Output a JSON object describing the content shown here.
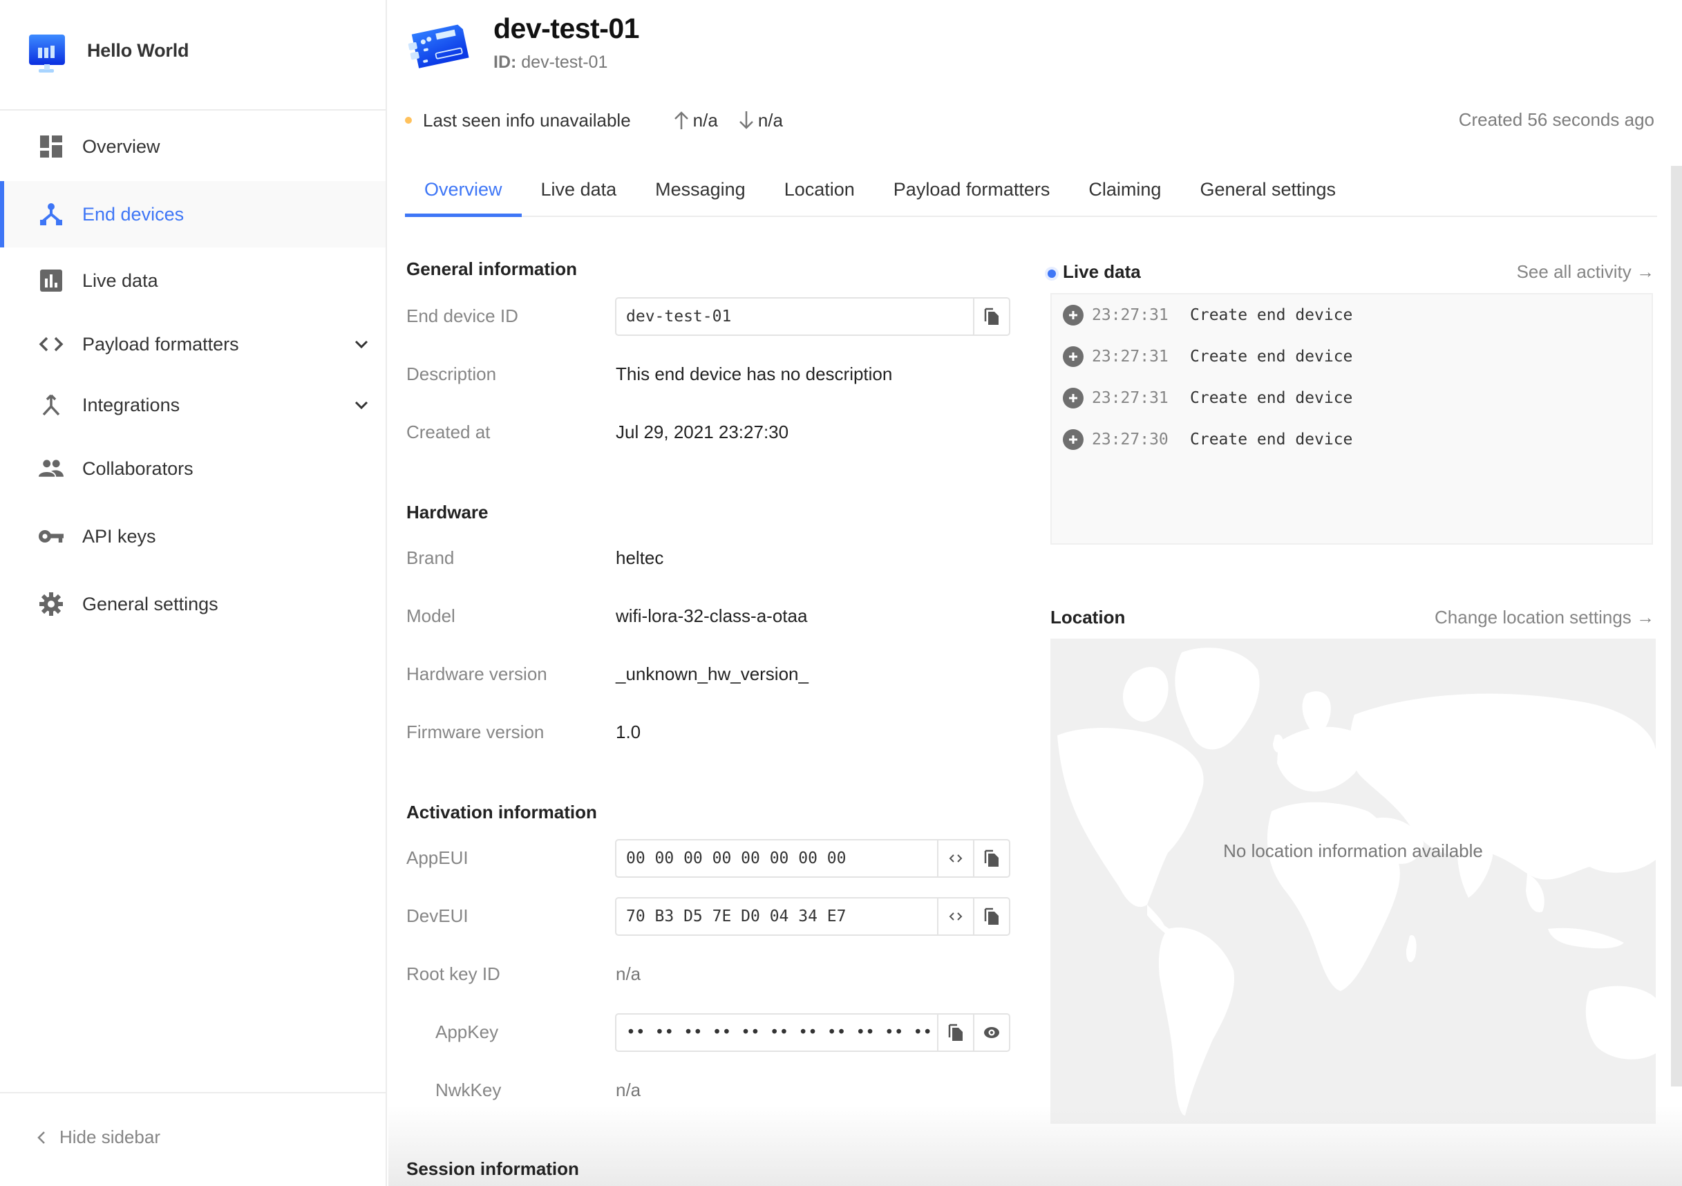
{
  "app": {
    "name": "Hello World",
    "logo_icon": "application-monitor-icon"
  },
  "sidebar": {
    "items": [
      {
        "label": "Overview",
        "icon": "dashboard-icon",
        "active": false,
        "expandable": false
      },
      {
        "label": "End devices",
        "icon": "devices-tree-icon",
        "active": true,
        "expandable": false
      },
      {
        "label": "Live data",
        "icon": "bar-chart-icon",
        "active": false,
        "expandable": false
      },
      {
        "label": "Payload formatters",
        "icon": "code-icon",
        "active": false,
        "expandable": true
      },
      {
        "label": "Integrations",
        "icon": "merge-icon",
        "active": false,
        "expandable": true
      },
      {
        "label": "Collaborators",
        "icon": "people-icon",
        "active": false,
        "expandable": false
      },
      {
        "label": "API keys",
        "icon": "key-icon",
        "active": false,
        "expandable": false
      },
      {
        "label": "General settings",
        "icon": "gear-icon",
        "active": false,
        "expandable": false
      }
    ],
    "hide_label": "Hide sidebar"
  },
  "device": {
    "title": "dev-test-01",
    "id_label": "ID:",
    "id_value": "dev-test-01",
    "last_seen": "Last seen info unavailable",
    "uplink": "n/a",
    "downlink": "n/a",
    "created_ago": "Created 56 seconds ago",
    "status_color": "#ffc15c"
  },
  "tabs": [
    {
      "label": "Overview",
      "active": true
    },
    {
      "label": "Live data",
      "active": false
    },
    {
      "label": "Messaging",
      "active": false
    },
    {
      "label": "Location",
      "active": false
    },
    {
      "label": "Payload formatters",
      "active": false
    },
    {
      "label": "Claiming",
      "active": false
    },
    {
      "label": "General settings",
      "active": false
    }
  ],
  "general": {
    "title": "General information",
    "end_device_id_label": "End device ID",
    "end_device_id_value": "dev-test-01",
    "description_label": "Description",
    "description_value": "This end device has no description",
    "created_at_label": "Created at",
    "created_at_value": "Jul 29, 2021 23:27:30"
  },
  "hardware": {
    "title": "Hardware",
    "brand_label": "Brand",
    "brand_value": "heltec",
    "model_label": "Model",
    "model_value": "wifi-lora-32-class-a-otaa",
    "hw_version_label": "Hardware version",
    "hw_version_value": "_unknown_hw_version_",
    "fw_version_label": "Firmware version",
    "fw_version_value": "1.0"
  },
  "activation": {
    "title": "Activation information",
    "appeui_label": "AppEUI",
    "appeui_value": "00 00 00 00 00 00 00 00",
    "deveui_label": "DevEUI",
    "deveui_value": "70 B3 D5 7E D0 04 34 E7",
    "root_key_id_label": "Root key ID",
    "root_key_id_value": "n/a",
    "appkey_label": "AppKey",
    "appkey_value": "•• •• •• •• •• •• •• •• •• •• •• •• •• •• •• ••",
    "nwkkey_label": "NwkKey",
    "nwkkey_value": "n/a"
  },
  "session": {
    "title": "Session information"
  },
  "live_data": {
    "title": "Live data",
    "see_all": "See all activity →",
    "events": [
      {
        "time": "23:27:31",
        "message": "Create end device",
        "icon": "plus-circle-icon"
      },
      {
        "time": "23:27:31",
        "message": "Create end device",
        "icon": "plus-circle-icon"
      },
      {
        "time": "23:27:31",
        "message": "Create end device",
        "icon": "plus-circle-icon"
      },
      {
        "time": "23:27:30",
        "message": "Create end device",
        "icon": "plus-circle-icon"
      }
    ]
  },
  "location": {
    "title": "Location",
    "change_link": "Change location settings →",
    "empty_message": "No location information available"
  },
  "colors": {
    "accent": "#3e76f6",
    "muted_text": "#858585",
    "border": "#e3e3e3"
  }
}
